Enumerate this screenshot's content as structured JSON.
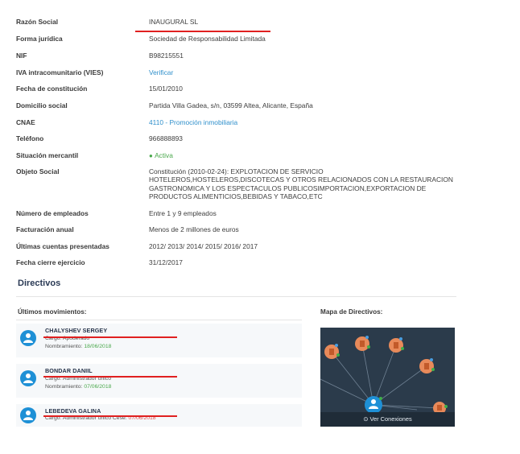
{
  "company": {
    "rows": [
      {
        "label": "Razón Social",
        "value": "INAUGURAL SL"
      },
      {
        "label": "Forma jurídica",
        "value": "Sociedad de Responsabilidad Limitada"
      },
      {
        "label": "NIF",
        "value": "B98215551"
      },
      {
        "label": "IVA intracomunitario (VIES)",
        "value": "Verificar"
      },
      {
        "label": "Fecha de constitución",
        "value": "15/01/2010"
      },
      {
        "label": "Domicilio social",
        "value": "Partida Villa Gadea, s/n, 03599 Altea, Alicante, España"
      },
      {
        "label": "CNAE",
        "value": "4110 - Promoción inmobiliaria"
      },
      {
        "label": "Teléfono",
        "value": "966888893"
      },
      {
        "label": "Situación mercantil",
        "value": "Activa"
      },
      {
        "label": "Objeto Social",
        "value_lines": [
          "Constitución (2010-02-24): EXPLOTACION DE SERVICIO",
          "HOTELEROS,HOSTELEROS,DISCOTECAS Y OTROS RELACIONADOS CON LA RESTAURACION",
          "GASTRONOMICA Y LOS ESPECTACULOS PUBLICOSIMPORTACION,EXPORTACION DE",
          "PRODUCTOS ALIMENTICIOS,BEBIDAS Y TABACO,ETC"
        ]
      },
      {
        "label": "Número de empleados",
        "value": "Entre 1 y 9 empleados"
      },
      {
        "label": "Facturación anual",
        "value": "Menos de 2 millones de euros"
      },
      {
        "label": "Últimas cuentas presentadas",
        "value": "2012/ 2013/ 2014/ 2015/ 2016/ 2017"
      },
      {
        "label": "Fecha cierre ejercicio",
        "value": "31/12/2017"
      }
    ]
  },
  "directivos": {
    "title": "Directivos",
    "movimientos_label": "Últimos movimientos:",
    "mapa_label": "Mapa de Directivos:",
    "people": [
      {
        "name": "CHALYSHEV SERGEY",
        "line1_label": "Cargo:",
        "line1_value": "Apoderado",
        "line2_label": "Nombramiento:",
        "line2_value": "18/06/2018"
      },
      {
        "name": "BONDAR DANIIL",
        "line1_label": "Cargo:",
        "line1_value": "Administrador único",
        "line2_label": "Nombramiento:",
        "line2_value": "07/06/2018"
      },
      {
        "name": "LEBEDEVA GALINA",
        "line1_label": "Cargo:",
        "line1_value": "Administrador único",
        "line1_extra_label": "Cese:",
        "line1_extra_value": "07/06/2018"
      }
    ],
    "map_button": "Ver Conexiones"
  },
  "colors": {
    "link": "#2f8fcb",
    "active": "#49a84b",
    "underline": "#e02020",
    "avatar": "#1e90d6",
    "map_bg": "#2b3b4b",
    "node": "#e88a5a"
  }
}
